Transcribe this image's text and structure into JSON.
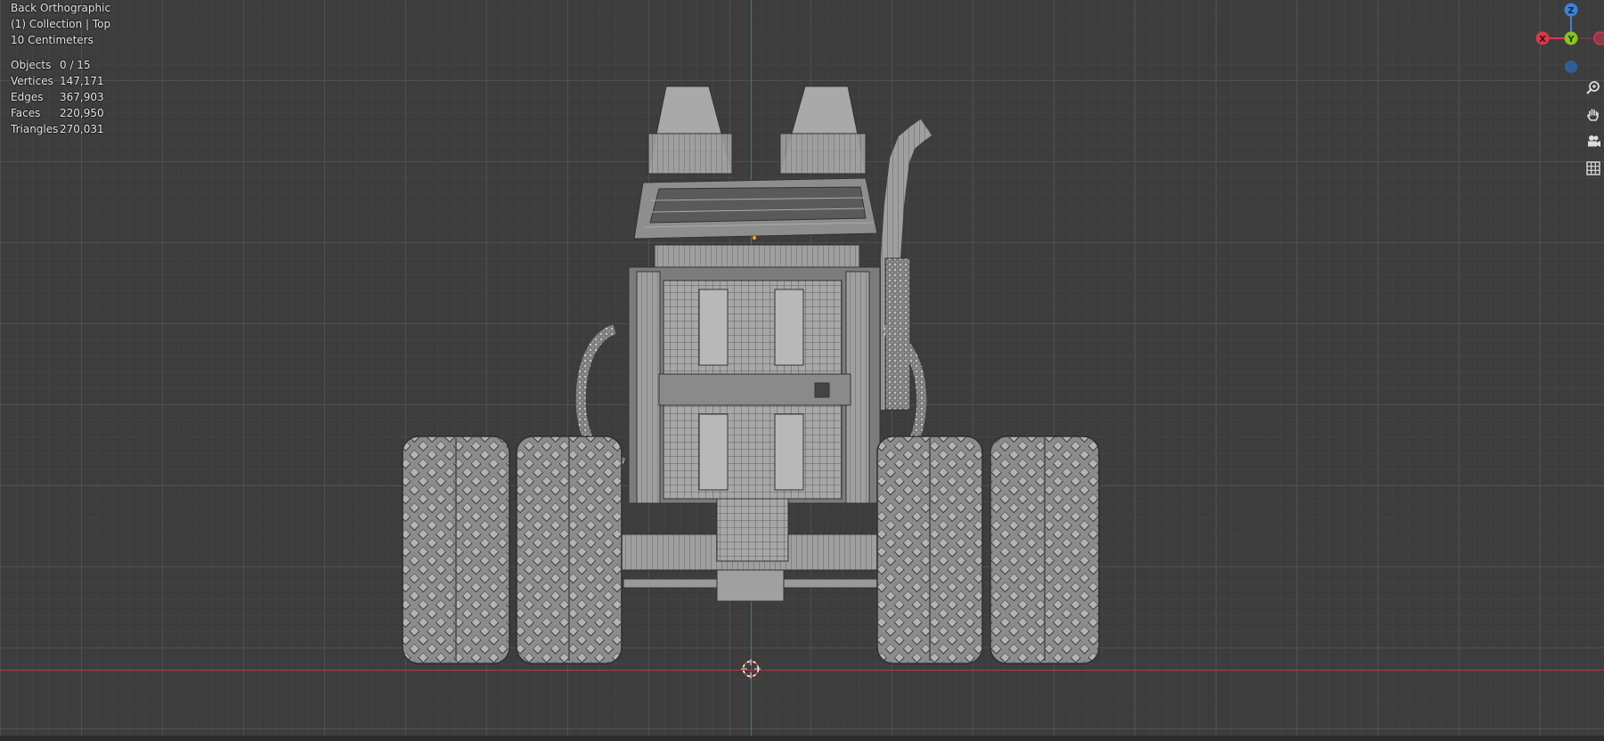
{
  "viewport": {
    "view_name": "Back Orthographic",
    "collection": "(1) Collection | Top",
    "grid_scale": "10 Centimeters",
    "stats": [
      {
        "label": "Objects",
        "value": "0 / 15"
      },
      {
        "label": "Vertices",
        "value": "147,171"
      },
      {
        "label": "Edges",
        "value": "367,903"
      },
      {
        "label": "Faces",
        "value": "220,950"
      },
      {
        "label": "Triangles",
        "value": "270,031"
      }
    ]
  },
  "gizmo": {
    "z_label": "Z",
    "x_label": "X",
    "y_label": "Y",
    "colors": {
      "x": "#d6394b",
      "y": "#8ac41f",
      "z": "#3a84d8"
    }
  },
  "nav_tools": [
    {
      "name": "zoom-icon"
    },
    {
      "name": "pan-hand-icon"
    },
    {
      "name": "camera-view-icon"
    },
    {
      "name": "toggle-ortho-grid-icon"
    }
  ],
  "colors": {
    "background": "#3d3d3d",
    "z_axis": "#3b6fbd",
    "x_axis": "#a8424a",
    "wireframe": "#9a9a9a"
  }
}
